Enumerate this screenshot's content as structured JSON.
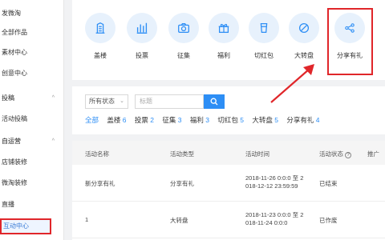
{
  "sidebar": {
    "items": [
      {
        "label": "发微淘"
      },
      {
        "label": "全部作品"
      },
      {
        "label": "素材中心"
      },
      {
        "label": "创意中心"
      },
      {
        "label": "投稿"
      },
      {
        "label": "活动投稿"
      },
      {
        "label": "自运营"
      },
      {
        "label": "店铺装修"
      },
      {
        "label": "微淘装修"
      },
      {
        "label": "直播"
      },
      {
        "label": "互动中心"
      }
    ],
    "active_label": "互动中心"
  },
  "activities": {
    "items": [
      {
        "label": "盖楼",
        "icon": "building-icon"
      },
      {
        "label": "投票",
        "icon": "bar-chart-icon"
      },
      {
        "label": "征集",
        "icon": "camera-icon"
      },
      {
        "label": "福利",
        "icon": "gift-icon"
      },
      {
        "label": "切红包",
        "icon": "cup-icon"
      },
      {
        "label": "大转盘",
        "icon": "no-sign-icon"
      },
      {
        "label": "分享有礼",
        "icon": "share-icon"
      }
    ],
    "highlighted": "分享有礼"
  },
  "filter": {
    "status_select": "所有状态",
    "search_placeholder": "标题",
    "tabs": [
      {
        "label": "全部",
        "count": ""
      },
      {
        "label": "盖楼",
        "count": "6"
      },
      {
        "label": "投票",
        "count": "2"
      },
      {
        "label": "征集",
        "count": "3"
      },
      {
        "label": "福利",
        "count": "3"
      },
      {
        "label": "切红包",
        "count": "5"
      },
      {
        "label": "大转盘",
        "count": "5"
      },
      {
        "label": "分享有礼",
        "count": "4"
      }
    ]
  },
  "table": {
    "headers": {
      "name": "活动名称",
      "type": "活动类型",
      "time": "活动时间",
      "status": "活动状态",
      "help": "?",
      "promote": "推广"
    },
    "rows": [
      {
        "name": "新分享有礼",
        "type": "分享有礼",
        "time_line1": "2018-11-26 0:0:0 至 2",
        "time_line2": "018-12-12 23:59:59",
        "status": "已结束"
      },
      {
        "name": "1",
        "type": "大转盘",
        "time_line1": "2018-11-23 0:0:0 至 2",
        "time_line2": "018-11-24 0:0:0",
        "status": "已作废"
      }
    ]
  },
  "colors": {
    "accent": "#2d8ef5",
    "highlight": "#e0262a",
    "icon_bg": "#e7f1fc"
  }
}
